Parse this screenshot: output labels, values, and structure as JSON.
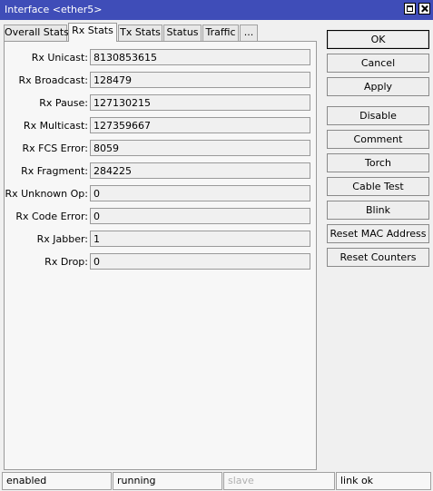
{
  "window": {
    "title": "Interface <ether5>"
  },
  "tabs": [
    "Overall Stats",
    "Rx Stats",
    "Tx Stats",
    "Status",
    "Traffic",
    "..."
  ],
  "active_tab": "Rx Stats",
  "fields": [
    {
      "label": "Rx Unicast:",
      "value": "8130853615"
    },
    {
      "label": "Rx Broadcast:",
      "value": "128479"
    },
    {
      "label": "Rx Pause:",
      "value": "127130215"
    },
    {
      "label": "Rx Multicast:",
      "value": "127359667"
    },
    {
      "label": "Rx FCS Error:",
      "value": "8059"
    },
    {
      "label": "Rx Fragment:",
      "value": "284225"
    },
    {
      "label": "Rx Unknown Op:",
      "value": "0"
    },
    {
      "label": "Rx Code Error:",
      "value": "0"
    },
    {
      "label": "Rx Jabber:",
      "value": "1"
    },
    {
      "label": "Rx Drop:",
      "value": "0"
    }
  ],
  "buttons": [
    "OK",
    "Cancel",
    "Apply",
    "Disable",
    "Comment",
    "Torch",
    "Cable Test",
    "Blink",
    "Reset MAC Address",
    "Reset Counters"
  ],
  "status": [
    "enabled",
    "running",
    "slave",
    "link ok"
  ],
  "colors": {
    "titlebar": "#3f4db8",
    "disabled_text": "#b0b0b0"
  }
}
